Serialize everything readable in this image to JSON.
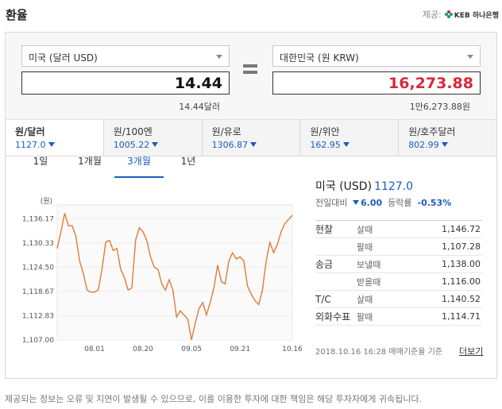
{
  "header": {
    "title": "환율",
    "provider_label": "제공:",
    "provider_name": "KEB 하나은행"
  },
  "converter": {
    "from_currency": "미국 (달러 USD)",
    "to_currency": "대한민국 (원 KRW)",
    "from_amount": "14.44",
    "to_amount": "16,273.88",
    "from_text": "14.44달러",
    "to_text": "1만6,273.88원"
  },
  "currency_tabs": [
    {
      "name": "원/달러",
      "value": "1127.0"
    },
    {
      "name": "원/100엔",
      "value": "1005.22"
    },
    {
      "name": "원/유로",
      "value": "1306.87"
    },
    {
      "name": "원/위안",
      "value": "162.95"
    },
    {
      "name": "원/호주달러",
      "value": "802.99"
    }
  ],
  "period_tabs": [
    "1일",
    "1개월",
    "3개월",
    "1년"
  ],
  "active_period": "3개월",
  "info": {
    "country": "미국 (USD)",
    "rate": "1127.0",
    "change_label": "전일대비",
    "change": "6.00",
    "pct_label": "등락률",
    "pct": "-0.53%",
    "rows": [
      {
        "group": "현찰",
        "type": "살때",
        "value": "1,146.72"
      },
      {
        "group": "",
        "type": "팔때",
        "value": "1,107.28"
      },
      {
        "group": "송금",
        "type": "보낼때",
        "value": "1,138.00"
      },
      {
        "group": "",
        "type": "받을때",
        "value": "1,116.00"
      },
      {
        "group": "T/C",
        "type": "살때",
        "value": "1,140.52"
      },
      {
        "group": "외화수표",
        "type": "팔때",
        "value": "1,114.71"
      }
    ],
    "timestamp": "2018.10.16 16:28 매매기준율 기준",
    "more": "더보기"
  },
  "chart_data": {
    "type": "line",
    "ylabel": "(원)",
    "yticks": [
      1107.0,
      1112.83,
      1118.67,
      1124.5,
      1130.33,
      1136.17
    ],
    "ytick_labels": [
      "1,107.00",
      "1,112.83",
      "1,118.67",
      "1,124.50",
      "1,130.33",
      "1,136.17"
    ],
    "ylim": [
      1107.0,
      1139.5
    ],
    "xtick_labels": [
      "08.01",
      "08.20",
      "09.05",
      "09.21",
      "10.16"
    ],
    "xtick_index": [
      10,
      23,
      36,
      49,
      63
    ],
    "color": "#e07b39",
    "values": [
      1129.0,
      1133.0,
      1137.5,
      1134.5,
      1134.5,
      1132.0,
      1126.0,
      1123.0,
      1119.0,
      1118.5,
      1118.5,
      1119.0,
      1124.0,
      1130.5,
      1131.0,
      1128.5,
      1129.0,
      1124.0,
      1122.0,
      1119.0,
      1119.5,
      1131.0,
      1134.0,
      1133.0,
      1131.0,
      1127.0,
      1124.5,
      1124.0,
      1120.5,
      1119.0,
      1121.5,
      1119.0,
      1112.5,
      1114.0,
      1113.0,
      1112.0,
      1107.0,
      1111.0,
      1114.5,
      1116.0,
      1113.0,
      1116.0,
      1119.5,
      1125.0,
      1121.0,
      1120.5,
      1126.0,
      1128.0,
      1126.5,
      1127.0,
      1126.0,
      1120.0,
      1118.0,
      1116.5,
      1115.5,
      1119.0,
      1126.0,
      1130.5,
      1128.0,
      1130.0,
      1133.0,
      1135.0,
      1136.0,
      1137.0
    ]
  }
}
